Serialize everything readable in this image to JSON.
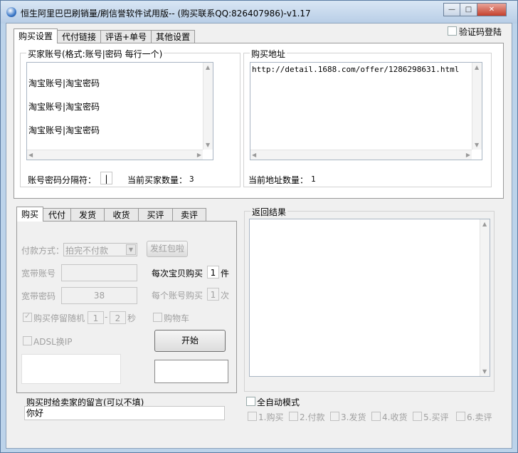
{
  "window": {
    "title": "恒生阿里巴巴刷销量/刷信誉软件试用版-- (购买联系QQ:826407986)-v1.17",
    "minimize": "—",
    "maximize": "□",
    "close": "✕"
  },
  "verify_login": {
    "label": "验证码登陆"
  },
  "top_tabs": [
    "购买设置",
    "代付链接",
    "评语+单号",
    "其他设置"
  ],
  "buyer": {
    "group_label": "买家账号(格式:账号|密码 每行一个)",
    "lines": [
      "淘宝账号|淘宝密码",
      "淘宝账号|淘宝密码",
      "淘宝账号|淘宝密码"
    ],
    "separator_label": "账号密码分隔符：",
    "separator_value": "|",
    "count_label": "当前买家数量：",
    "count": "3"
  },
  "address": {
    "group_label": "购买地址",
    "url": "http://detail.1688.com/offer/1286298631.html",
    "count_label": "当前地址数量：",
    "count": "1"
  },
  "sub_tabs": [
    "购买",
    "代付",
    "发货",
    "收货",
    "买评",
    "卖评"
  ],
  "purchase": {
    "pay_method_label": "付款方式：",
    "pay_method_value": "拍完不付款",
    "red_envelope_button": "发红包啦",
    "broadband_account_label": "宽带账号",
    "broadband_account_value": "",
    "broadband_password_label": "宽带密码",
    "broadband_password_value": "38",
    "per_item_label": "每次宝贝购买",
    "per_item_value": "1",
    "per_item_unit": "件",
    "per_account_label": "每个账号购买",
    "per_account_value": "1",
    "per_account_unit": "次",
    "random_stop_label": "购买停留随机",
    "random_min": "1",
    "random_dash": "-",
    "random_max": "2",
    "random_unit": "秒",
    "cart_label": "购物车",
    "adsl_label": "ADSL换IP",
    "start_button": "开始"
  },
  "results": {
    "group_label": "返回结果"
  },
  "message": {
    "label": "购买时给卖家的留言(可以不填)",
    "value": "你好"
  },
  "auto_mode": {
    "label": "全自动模式",
    "steps": [
      "1.购买",
      "2.付款",
      "3.发货",
      "4.收货",
      "5.买评",
      "6.卖评"
    ]
  }
}
